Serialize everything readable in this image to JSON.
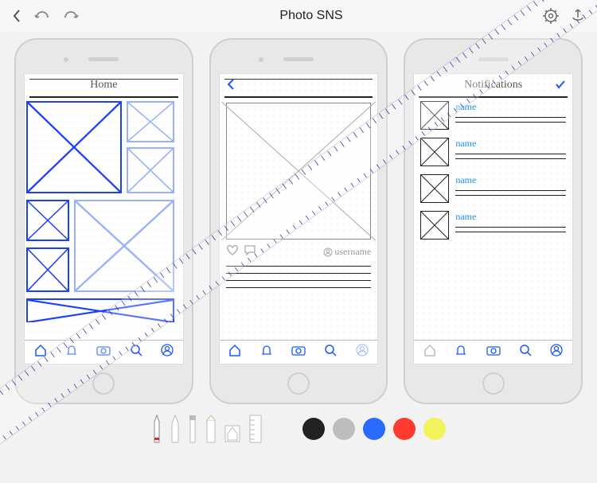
{
  "header": {
    "title": "Photo SNS"
  },
  "screens": {
    "home": {
      "title": "Home"
    },
    "detail": {
      "username": "username"
    },
    "notifs": {
      "title": "Notifications",
      "items": [
        {
          "name": "name"
        },
        {
          "name": "name"
        },
        {
          "name": "name"
        },
        {
          "name": "name"
        }
      ]
    }
  },
  "tabs": {
    "home": "home",
    "alerts": "alerts",
    "camera": "camera",
    "search": "search",
    "profile": "profile"
  },
  "palette": {
    "black": "#222222",
    "gray": "#bdbdbd",
    "blue": "#2a6bff",
    "red": "#ff3b2f",
    "yellow": "#f2f25a"
  }
}
